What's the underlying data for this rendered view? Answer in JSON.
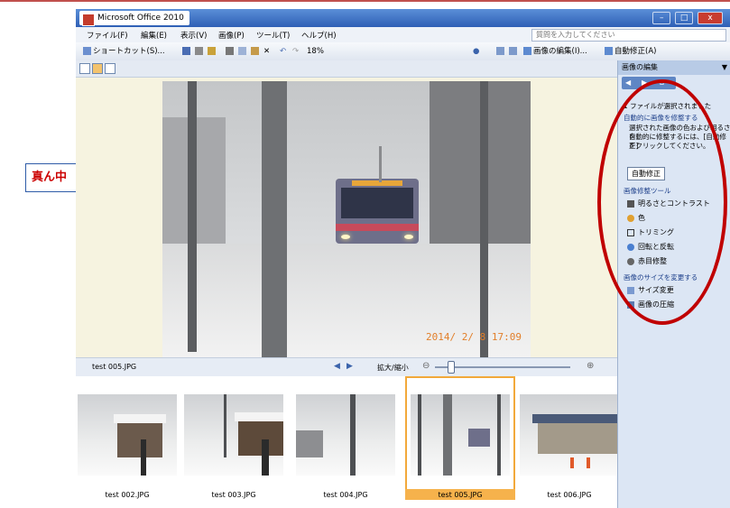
{
  "window": {
    "title": "Microsoft Office 2010",
    "controls": [
      "–",
      "□",
      "x"
    ]
  },
  "callout": {
    "text": "真ん中"
  },
  "menu": {
    "items": [
      "ファイル(F)",
      "編集(E)",
      "表示(V)",
      "画像(P)",
      "ツール(T)",
      "ヘルプ(H)"
    ],
    "help_placeholder": "質問を入力してください"
  },
  "toolbar": {
    "shortcut": "ショートカット(S)...",
    "zoom": "18%",
    "edit_picture": "画像の編集(I)...",
    "auto_correct": "自動修正(A)"
  },
  "photo": {
    "timestamp": "2014/ 2/ 8 17:09"
  },
  "status": {
    "filename": "test 005.JPG",
    "zoom_label": "拡大/縮小"
  },
  "thumbnails": [
    {
      "label": "test 002.JPG"
    },
    {
      "label": "test 003.JPG"
    },
    {
      "label": "test 004.JPG"
    },
    {
      "label": "test 005.JPG"
    },
    {
      "label": "test 006.JPG"
    }
  ],
  "pane": {
    "title": "画像の編集",
    "selected_info": "1 ファイルが選択されました",
    "auto_section": "自動的に画像を修整する",
    "auto_desc_1": "選択された画像の色および明るさを",
    "auto_desc_2": "自動的に修整するには、[自動修正]",
    "auto_desc_3": "をクリックしてください。",
    "auto_button": "自動修正",
    "tools_section": "画像修整ツール",
    "tools": [
      "明るさとコントラスト",
      "色",
      "トリミング",
      "回転と反転",
      "赤目修整"
    ],
    "size_section": "画像のサイズを変更する",
    "size_tools": [
      "サイズ変更",
      "画像の圧縮"
    ]
  },
  "colors": {
    "highlight_oval": "#c00000",
    "selection": "#f2a93b",
    "callout_text": "#cc0000"
  }
}
